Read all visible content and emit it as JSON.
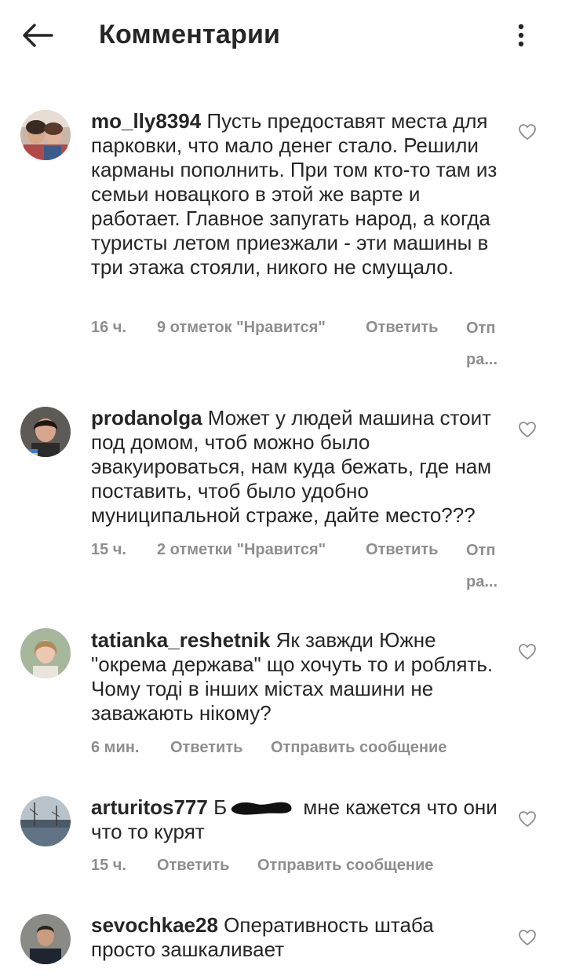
{
  "header": {
    "title": "Комментарии",
    "back_icon": "arrow-left-icon",
    "more_icon": "more-vertical-icon"
  },
  "comments": [
    {
      "username": "mo_lly8394",
      "text": "Пусть предоставят места для парковки, что мало денег стало. Решили карманы пополнить. При том кто-то там из семьи новацкого в этой же варте и работает. Главное запугать народ, а когда туристы летом приезжали - эти машины в три этажа стояли, никого не смущало.",
      "time": "16 ч.",
      "likes": "9 отметок \"Нравится\"",
      "reply": "Ответить",
      "send_line1": "Отп",
      "send_line2": "ра..."
    },
    {
      "username": "prodanolga",
      "text": "Может у людей машина стоит под домом,  чтоб можно было эвакуироваться, нам куда бежать, где нам поставить, чтоб было удобно муниципальной страже, дайте место???",
      "time": "15 ч.",
      "likes": "2 отметки \"Нравится\"",
      "reply": "Ответить",
      "send_line1": "Отп",
      "send_line2": "ра..."
    },
    {
      "username": "tatianka_reshetnik",
      "text": "Як завжди Южне \"окрема держава\" що хочуть то и роблять. Чому тоді в інших містах машини не заважають нікому?",
      "time": "6 мин.",
      "reply": "Ответить",
      "send": "Отправить сообщение"
    },
    {
      "username": "arturitos777",
      "text_before": "Б",
      "text": "мне кажется что они что то курят",
      "time": "15 ч.",
      "reply": "Ответить",
      "send": "Отправить сообщение"
    },
    {
      "username": "sevochkae28",
      "text": "Оперативность штаба просто зашкаливает"
    }
  ],
  "colors": {
    "text": "#262626",
    "secondary": "#8e8e8e"
  }
}
